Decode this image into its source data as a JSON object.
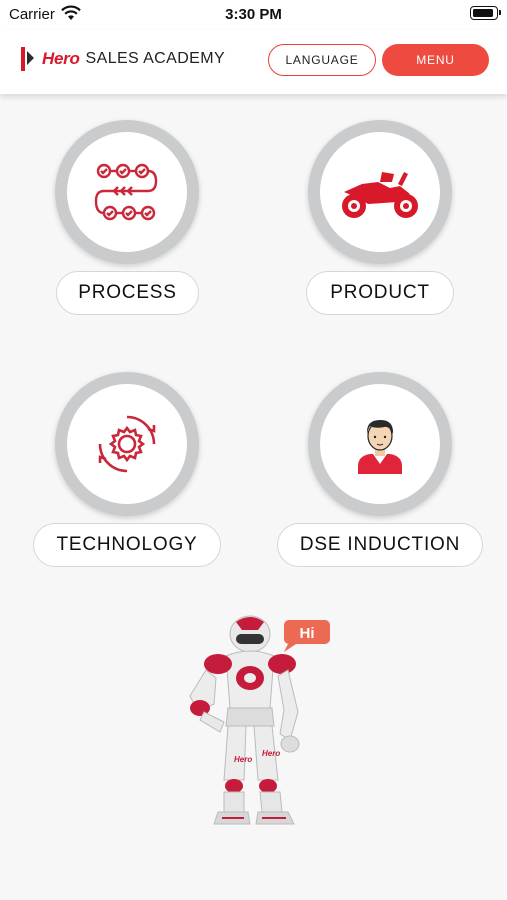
{
  "status_bar": {
    "carrier": "Carrier",
    "time": "3:30 PM"
  },
  "header": {
    "logo_brand": "Hero",
    "logo_rest": "SALES ACADEMY",
    "language_label": "LANGUAGE",
    "menu_label": "MENU"
  },
  "tiles": [
    {
      "label": "PROCESS",
      "icon": "process-flow-icon"
    },
    {
      "label": "PRODUCT",
      "icon": "motorcycle-icon"
    },
    {
      "label": "TECHNOLOGY",
      "icon": "gear-icon"
    },
    {
      "label": "DSE INDUCTION",
      "icon": "person-icon"
    }
  ],
  "robot": {
    "speech": "Hi",
    "badge_text": "Hero"
  },
  "colors": {
    "accent": "#ef4a3f",
    "brand_red": "#d8192a",
    "icon_red": "#c8283a",
    "ring_gray": "#c9cbcc"
  }
}
